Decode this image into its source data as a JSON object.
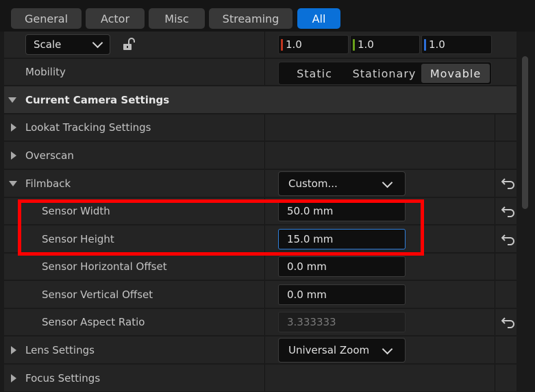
{
  "tabs": [
    {
      "label": "General"
    },
    {
      "label": "Actor"
    },
    {
      "label": "Misc"
    },
    {
      "label": "Streaming"
    },
    {
      "label": "All"
    }
  ],
  "transform": {
    "scale_dropdown": "Scale",
    "lock_icon": "unlock-icon",
    "scale_x": "1.0",
    "scale_y": "1.0",
    "scale_z": "1.0",
    "axis_colors": {
      "x": "#c0361f",
      "y": "#6aa11a",
      "z": "#2d6fd8"
    }
  },
  "mobility": {
    "label": "Mobility",
    "options": [
      "Static",
      "Stationary",
      "Movable"
    ],
    "selected": "Movable"
  },
  "current_camera": {
    "title": "Current Camera Settings"
  },
  "rows": {
    "lookat": "Lookat Tracking Settings",
    "overscan": "Overscan",
    "filmback": "Filmback",
    "filmback_value": "Custom...",
    "sensor_width": "Sensor Width",
    "sensor_width_value": "50.0 mm",
    "sensor_height": "Sensor Height",
    "sensor_height_value": "15.0 mm",
    "h_offset": "Sensor Horizontal Offset",
    "h_offset_value": "0.0 mm",
    "v_offset": "Sensor Vertical Offset",
    "v_offset_value": "0.0 mm",
    "aspect": "Sensor Aspect Ratio",
    "aspect_value": "3.333333",
    "lens": "Lens Settings",
    "lens_value": "Universal Zoom",
    "focus": "Focus Settings"
  },
  "colors": {
    "accent": "#0a70d8",
    "highlight": "#ff0000"
  }
}
